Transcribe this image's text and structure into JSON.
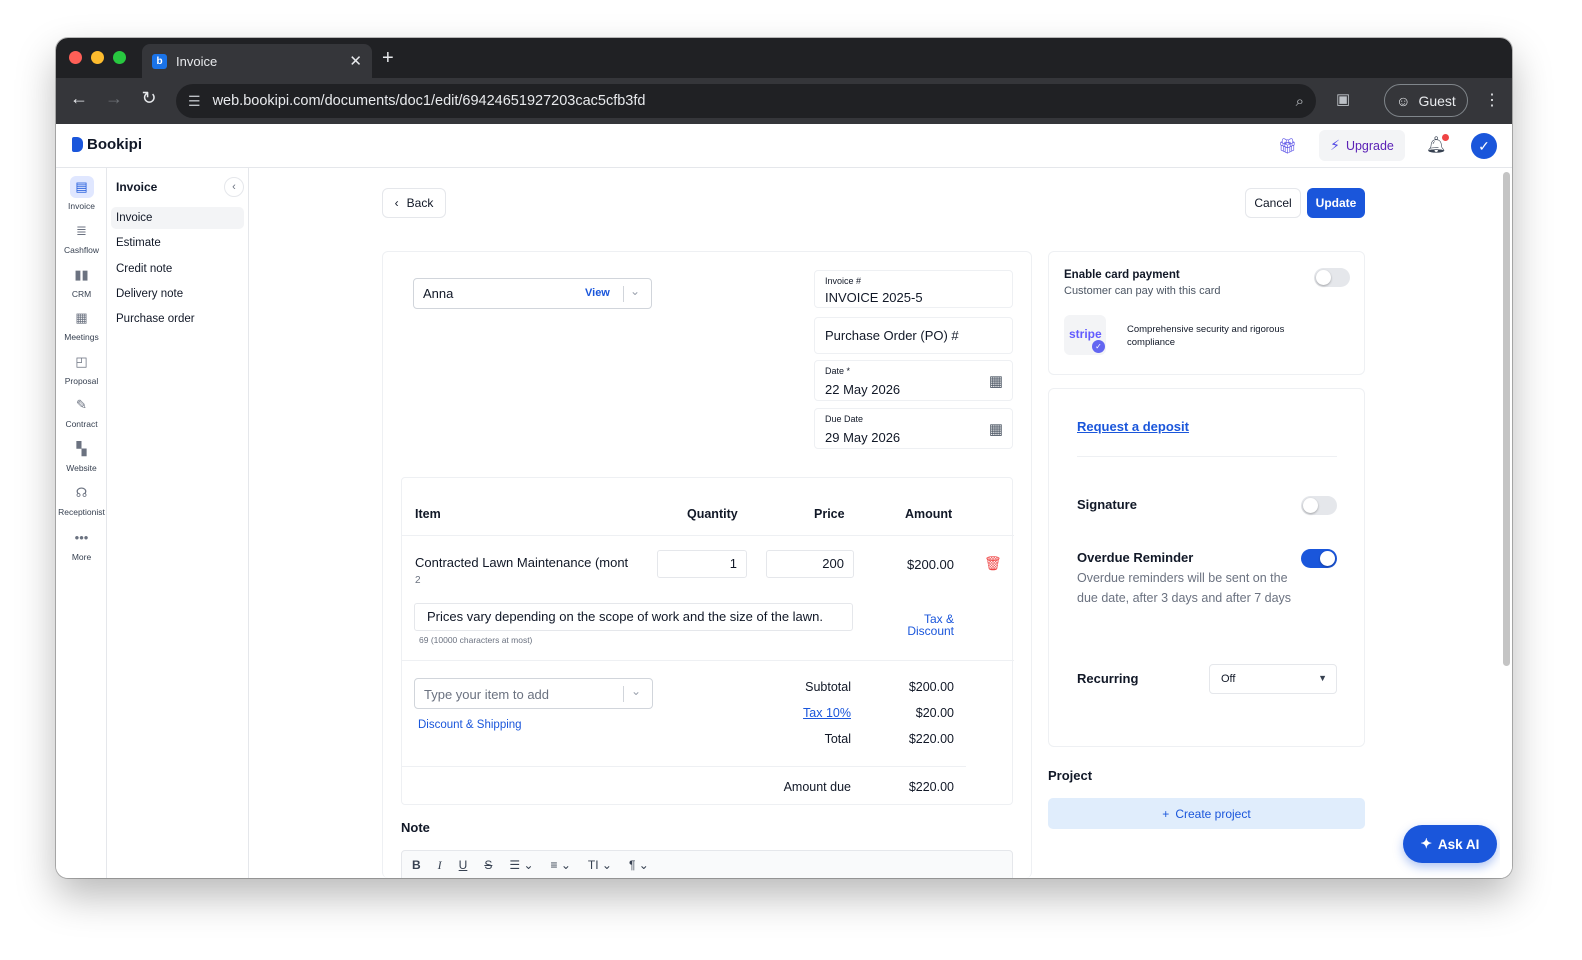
{
  "browser": {
    "tab_title": "Invoice",
    "url": "web.bookipi.com/documents/doc1/edit/69424651927203cac5cfb3fd",
    "profile_label": "Guest"
  },
  "app": {
    "brand": "Bookipi",
    "upgrade_label": "Upgrade",
    "ask_ai_label": "Ask AI"
  },
  "rail": [
    {
      "label": "Invoice",
      "icon": "invoice-icon"
    },
    {
      "label": "Cashflow",
      "icon": "cashflow-icon"
    },
    {
      "label": "CRM",
      "icon": "crm-icon"
    },
    {
      "label": "Meetings",
      "icon": "meetings-icon"
    },
    {
      "label": "Proposal",
      "icon": "proposal-icon"
    },
    {
      "label": "Contract",
      "icon": "contract-icon"
    },
    {
      "label": "Website",
      "icon": "website-icon"
    },
    {
      "label": "Receptionist",
      "icon": "receptionist-icon"
    },
    {
      "label": "More",
      "icon": "more-icon"
    }
  ],
  "subnav": {
    "heading": "Invoice",
    "items": [
      "Invoice",
      "Estimate",
      "Credit note",
      "Delivery note",
      "Purchase order"
    ]
  },
  "actions": {
    "back": "Back",
    "cancel": "Cancel",
    "update": "Update"
  },
  "document": {
    "client": "Anna",
    "client_view": "View",
    "invoice_label": "Invoice #",
    "invoice_number": "INVOICE 2025-5",
    "po_placeholder": "Purchase Order (PO) #",
    "date_label": "Date *",
    "date_value": "22 May 2026",
    "due_label": "Due Date",
    "due_value": "29 May 2026"
  },
  "items": {
    "headers": {
      "item": "Item",
      "quantity": "Quantity",
      "price": "Price",
      "amount": "Amount"
    },
    "rows": [
      {
        "name": "Contracted Lawn Maintenance (mont",
        "subline": "2",
        "quantity": "1",
        "price": "200",
        "amount": "$200.00",
        "description": "Prices vary depending on the scope of work and the size of the lawn.",
        "char_count": "69 (10000 characters at most)",
        "tax_link_line1": "Tax &",
        "tax_link_line2": "Discount"
      }
    ],
    "add_placeholder": "Type your item to add",
    "discount_link": "Discount & Shipping"
  },
  "totals": {
    "subtotal_label": "Subtotal",
    "subtotal": "$200.00",
    "tax_label": "Tax 10%",
    "tax": "$20.00",
    "total_label": "Total",
    "total": "$220.00",
    "due_label": "Amount due",
    "due": "$220.00"
  },
  "note": {
    "heading": "Note"
  },
  "payment": {
    "title": "Enable card payment",
    "subtitle": "Customer can pay with this card",
    "stripe_logo": "stripe",
    "stripe_text": "Comprehensive security and rigorous compliance",
    "enabled": false
  },
  "options": {
    "deposit_link": "Request a deposit",
    "signature_label": "Signature",
    "signature_on": false,
    "overdue_label": "Overdue Reminder",
    "overdue_desc": "Overdue reminders will be sent on the due date, after 3 days and after 7 days",
    "overdue_on": true,
    "recurring_label": "Recurring",
    "recurring_value": "Off"
  },
  "project": {
    "heading": "Project",
    "create_label": "Create project"
  },
  "colors": {
    "accent": "#1a56db",
    "danger": "#ef4444"
  }
}
